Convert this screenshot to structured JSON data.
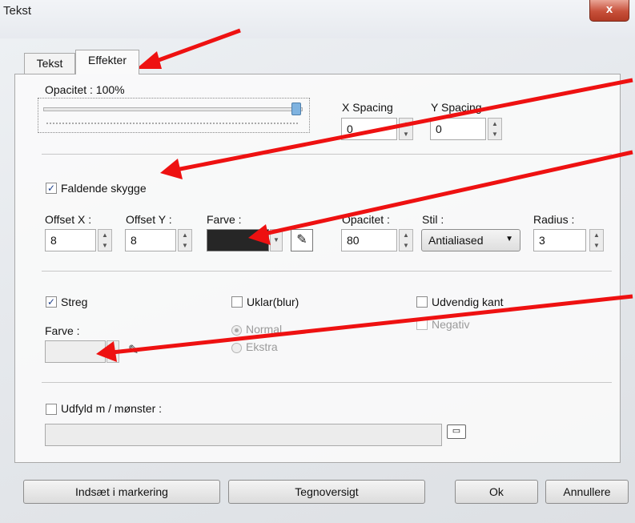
{
  "window": {
    "title": "Tekst",
    "close_glyph": "x"
  },
  "tabs": [
    {
      "label": "Tekst"
    },
    {
      "label": "Effekter"
    }
  ],
  "opacity": {
    "label": "Opacitet : 100%",
    "value_percent": 100
  },
  "spacing": {
    "x_label": "X Spacing",
    "x_value": "0",
    "y_label": "Y Spacing",
    "y_value": "0"
  },
  "shadow": {
    "checkbox_label": "Faldende skygge",
    "checked": true,
    "offset_x_label": "Offset X :",
    "offset_x_value": "8",
    "offset_y_label": "Offset Y :",
    "offset_y_value": "8",
    "color_label": "Farve :",
    "color": "#262626",
    "opacity_label": "Opacitet :",
    "opacity_value": "80",
    "style_label": "Stil :",
    "style_value": "Antialiased",
    "radius_label": "Radius :",
    "radius_value": "3"
  },
  "stroke": {
    "checkbox_label": "Streg",
    "checked": true,
    "blur_label": "Uklar(blur)",
    "outer_edge_label": "Udvendig kant",
    "negative_label": "Negativ",
    "color_label": "Farve :",
    "radio_normal": "Normal",
    "radio_extra": "Ekstra"
  },
  "fill": {
    "checkbox_label": "Udfyld m / mønster :"
  },
  "buttons": {
    "insert": "Indsæt i markering",
    "charmap": "Tegnoversigt",
    "ok": "Ok",
    "cancel": "Annullere"
  },
  "colors": {
    "annotation_arrow": "#ee1111",
    "accent": "#1c3f8a"
  },
  "icons": [
    "eyedropper-icon",
    "folder-open-icon",
    "dropdown-arrow-icon",
    "spin-up-icon",
    "spin-down-icon",
    "checkmark-icon"
  ]
}
